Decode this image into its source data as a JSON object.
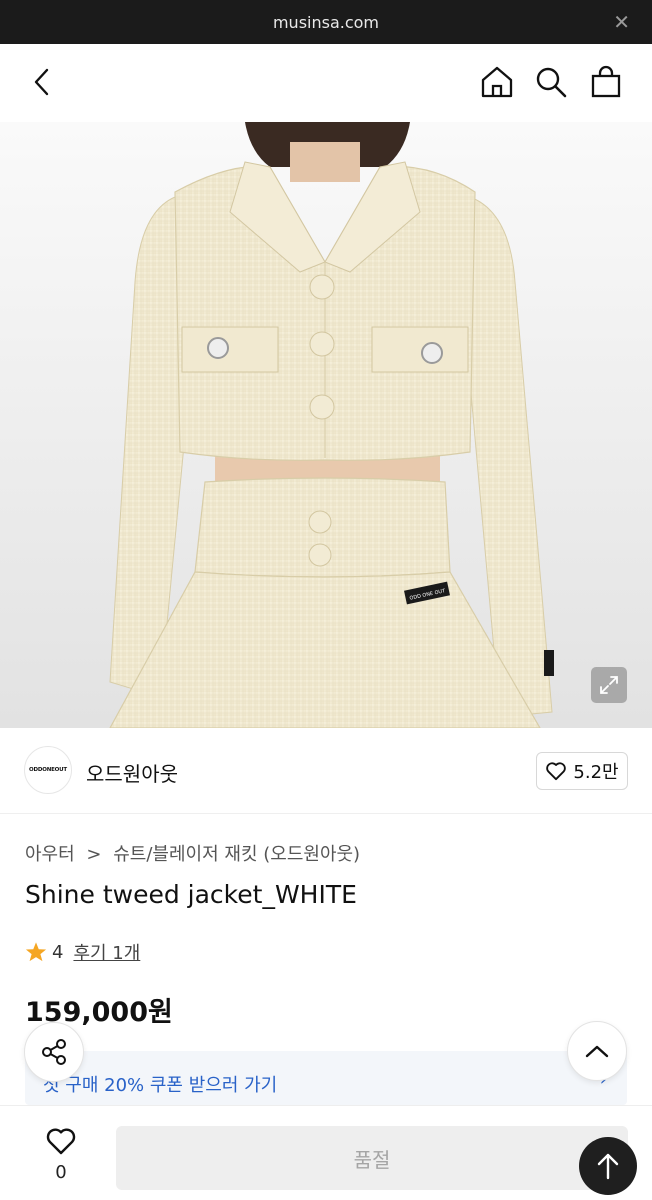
{
  "browser": {
    "url": "musinsa.com",
    "close_icon": "close-icon"
  },
  "header": {
    "icons": [
      "back-arrow-icon",
      "home-icon",
      "search-icon",
      "shopping-bag-icon"
    ]
  },
  "product_image": {
    "label_text": "ODD ONE OUT",
    "expand_icon": "expand-icon"
  },
  "brand": {
    "logo_text": "ODDONEOUT",
    "name": "오드원아웃",
    "likes": "5.2만"
  },
  "product": {
    "breadcrumb": {
      "category": "아우터",
      "separator": ">",
      "subcategory": "슈트/블레이저 재킷 (오드원아웃)"
    },
    "title": "Shine tweed jacket_WHITE",
    "rating": "4",
    "reviews": "후기 1개",
    "price": "159,000원"
  },
  "coupon": {
    "text": "첫 구매 20% 쿠폰 받으러 가기",
    "arrow": "›"
  },
  "bottom_bar": {
    "wish_count": "0",
    "buy_button": "품절"
  },
  "colors": {
    "accent_blue": "#2962c8",
    "star": "#f5a623",
    "browser_bar": "#1b1b1b"
  }
}
